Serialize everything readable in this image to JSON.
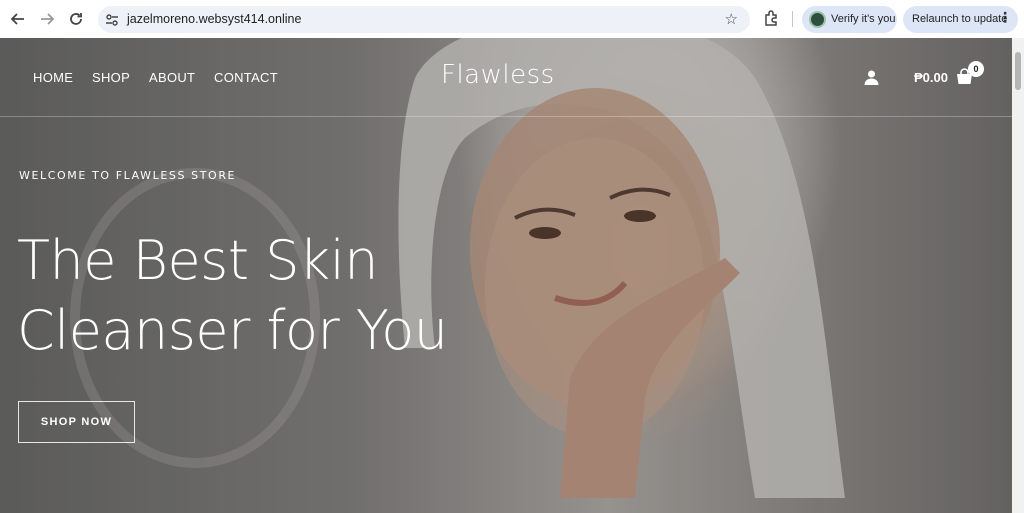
{
  "browser": {
    "url": "jazelmoreno.websyst414.online",
    "verify_label": "Verify it's you",
    "relaunch_label": "Relaunch to update"
  },
  "site": {
    "logo": "Flawless",
    "nav": [
      "HOME",
      "SHOP",
      "ABOUT",
      "CONTACT"
    ],
    "cart_total": "₱0.00",
    "cart_count": "0"
  },
  "hero": {
    "eyebrow": "WELCOME TO FLAWLESS STORE",
    "headline_line1": "The Best Skin",
    "headline_line2": "Cleanser for You",
    "cta": "SHOP NOW"
  },
  "icons": {
    "back": "back-arrow-icon",
    "forward": "forward-arrow-icon",
    "reload": "reload-icon",
    "site_info": "tune-icon",
    "bookmark": "star-icon",
    "extensions": "puzzle-icon",
    "menu": "more-vertical-icon",
    "account": "user-icon",
    "cart": "shopping-bag-icon"
  }
}
